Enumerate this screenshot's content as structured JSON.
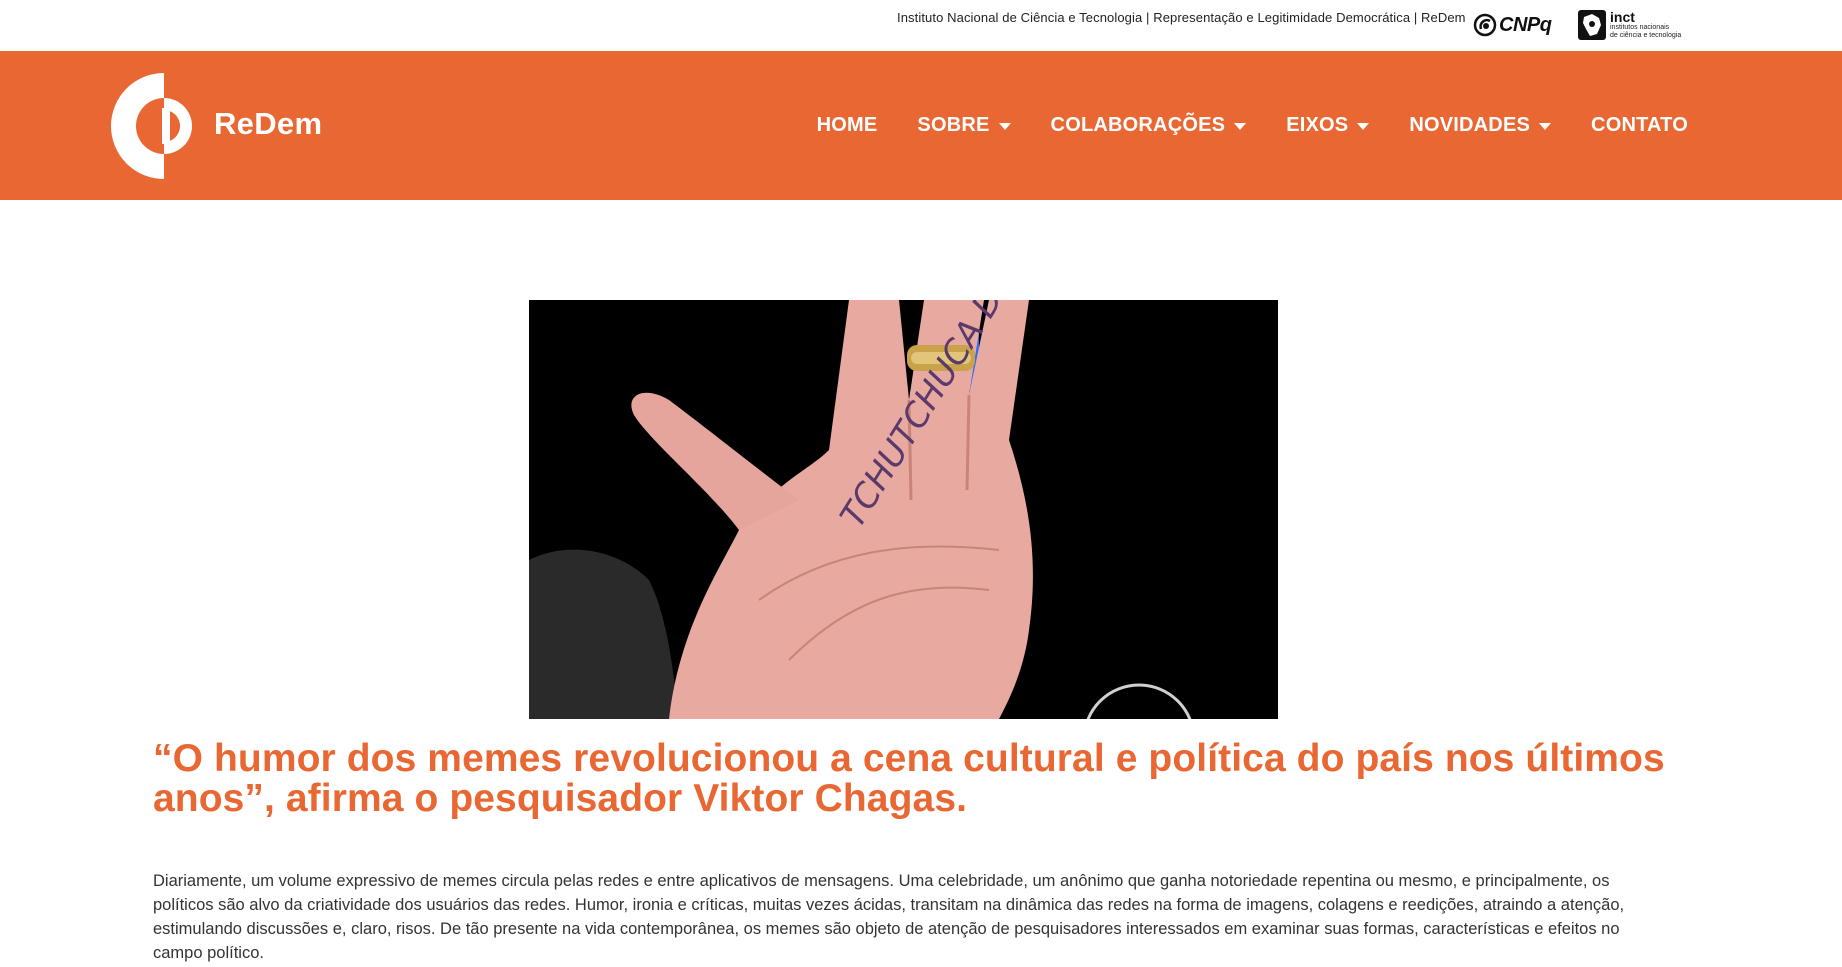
{
  "topbar": {
    "text": "Instituto Nacional de Ciência e Tecnologia | Representação e Legitimidade Democrática | ReDem",
    "cnpq_logo_text": "CNPq",
    "inct_logo_title": "inct",
    "inct_logo_line1": "institutos nacionais",
    "inct_logo_line2": "de ciência e tecnologia"
  },
  "header": {
    "logo_text": "ReDem",
    "background_color": "#e96733",
    "nav": [
      {
        "label": "HOME",
        "has_dropdown": false
      },
      {
        "label": "SOBRE",
        "has_dropdown": true
      },
      {
        "label": "COLABORAÇÕES",
        "has_dropdown": true
      },
      {
        "label": "EIXOS",
        "has_dropdown": true
      },
      {
        "label": "NOVIDADES",
        "has_dropdown": true
      },
      {
        "label": "CONTATO",
        "has_dropdown": false
      }
    ]
  },
  "article": {
    "image_handwriting": "TCHUTCHUCA DO CENTRÃO",
    "headline": "“O humor dos memes revolucionou a cena cultural e política do país nos últimos anos”, afirma o pesquisador Viktor Chagas.",
    "body": "Diariamente, um volume expressivo de memes circula pelas redes e entre aplicativos de mensagens. Uma celebridade, um anônimo que ganha notoriedade repentina ou mesmo, e principalmente, os políticos são alvo da criatividade dos usuários das redes. Humor, ironia e críticas, muitas vezes ácidas, transitam na dinâmica das redes na forma de imagens, colagens e reedições, atraindo a atenção, estimulando discussões e, claro, risos. De tão presente na vida contemporânea, os memes são objeto de atenção de pesquisadores interessados em examinar suas formas, características e efeitos no campo político."
  },
  "colors": {
    "accent": "#e96733",
    "text": "#333333"
  }
}
